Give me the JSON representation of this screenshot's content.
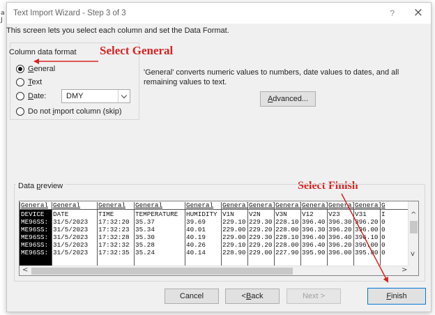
{
  "window": {
    "title": "Text Import Wizard - Step 3 of 3",
    "help_glyph": "?",
    "close_glyph": "×"
  },
  "intro_text": "This screen lets you select each column and set the Data Format.",
  "column_format": {
    "legend": "Column data format",
    "options": [
      {
        "accel": "G",
        "rest": "eneral",
        "selected": true
      },
      {
        "accel": "T",
        "rest": "ext",
        "selected": false
      },
      {
        "accel": "D",
        "rest": "ate:",
        "selected": false
      },
      {
        "pre": "Do not ",
        "accel": "i",
        "rest": "mport column (skip)",
        "selected": false
      }
    ],
    "date_value": "DMY",
    "description": "'General' converts numeric values to numbers, date values to dates, and all remaining values to text.",
    "advanced_pre": "",
    "advanced_accel": "A",
    "advanced_rest": "dvanced..."
  },
  "annotations": {
    "select_general": "Select General",
    "select_finish": "Select Finish",
    "color": "#d92222"
  },
  "preview": {
    "legend_pre": "Data ",
    "legend_accel": "p",
    "legend_rest": "review",
    "headers": [
      "General",
      "General",
      "General",
      "General",
      "General",
      "General",
      "General",
      "General",
      "General",
      "General",
      "General",
      "G"
    ],
    "rows": [
      [
        "DEVICE",
        "DATE",
        "TIME",
        "TEMPERATURE",
        "HUMIDITY",
        "V1N",
        "V2N",
        "V3N",
        "V12",
        "V23",
        "V31",
        "I"
      ],
      [
        "ME96SS:",
        "31/5/2023",
        "17:32:20",
        "35.37",
        "39.69",
        "229.10",
        "229.30",
        "228.10",
        "396.40",
        "396.30",
        "396.20",
        "0"
      ],
      [
        "ME96SS:",
        "31/5/2023",
        "17:32:23",
        "35.34",
        "40.01",
        "229.00",
        "229.20",
        "228.00",
        "396.30",
        "396.20",
        "396.00",
        "0"
      ],
      [
        "ME96SS:",
        "31/5/2023",
        "17:32:28",
        "35.30",
        "40.19",
        "229.00",
        "229.30",
        "228.10",
        "396.40",
        "396.40",
        "396.10",
        "0"
      ],
      [
        "ME96SS:",
        "31/5/2023",
        "17:32:32",
        "35.28",
        "40.26",
        "229.10",
        "229.20",
        "228.00",
        "396.40",
        "396.20",
        "396.00",
        "0"
      ],
      [
        "ME96SS:",
        "31/5/2023",
        "17:32:35",
        "35.24",
        "40.14",
        "228.90",
        "229.00",
        "227.90",
        "395.90",
        "396.00",
        "395.80",
        "0"
      ]
    ],
    "scroll_up": "^",
    "scroll_down": "v",
    "scroll_left": "<",
    "scroll_right": ">"
  },
  "buttons": {
    "cancel": "Cancel",
    "back_pre": "< ",
    "back_accel": "B",
    "back_rest": "ack",
    "next": "Next >",
    "finish_accel": "F",
    "finish_rest": "inish"
  },
  "edge_marks": [
    "a",
    "J"
  ]
}
